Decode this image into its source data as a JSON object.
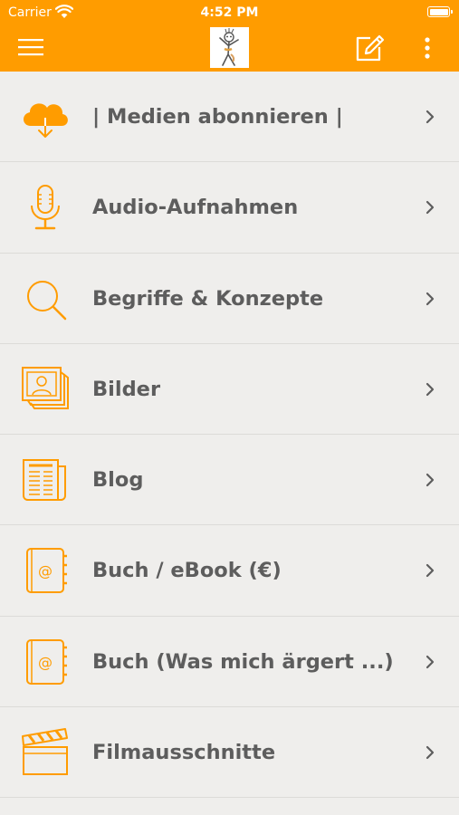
{
  "status_bar": {
    "carrier": "Carrier",
    "time": "4:52 PM"
  },
  "nav": {
    "menu_icon": "hamburger-icon",
    "logo": "app-logo",
    "edit_icon": "edit-icon",
    "more_icon": "more-vertical-icon"
  },
  "colors": {
    "brand": "#ff9c00",
    "background": "#efeeec",
    "text": "#5d5d5d",
    "divider": "#dcdbd8"
  },
  "menu": {
    "items": [
      {
        "label": "| Medien abonnieren |",
        "icon": "cloud-download-icon"
      },
      {
        "label": "Audio-Aufnahmen",
        "icon": "microphone-icon"
      },
      {
        "label": "Begriffe & Konzepte",
        "icon": "search-icon"
      },
      {
        "label": "Bilder",
        "icon": "photos-icon"
      },
      {
        "label": "Blog",
        "icon": "newspaper-icon"
      },
      {
        "label": "Buch / eBook (€)",
        "icon": "address-book-icon"
      },
      {
        "label": "Buch (Was mich ärgert ...)",
        "icon": "address-book-icon"
      },
      {
        "label": "Filmausschnitte",
        "icon": "clapperboard-icon"
      }
    ]
  }
}
